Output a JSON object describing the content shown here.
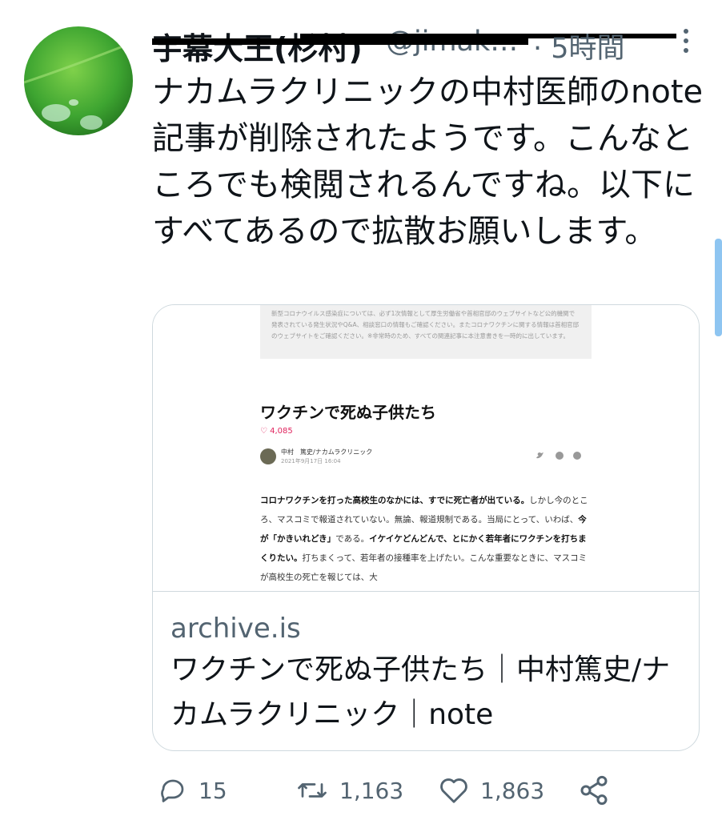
{
  "tweet": {
    "display_name": "宇幕大王(杉村)",
    "handle": "@jimak…",
    "time": "· 5時間",
    "text": "ナカムラクリニックの中村医師のnote記事が削除されたようです。こんなところでも検閲されるんですね。以下にすべてあるので拡散お願いします。"
  },
  "card": {
    "notice": "新型コロナウイルス感染症については、必ず1次情報として厚生労働省や首相官邸のウェブサイトなど公的機関で発表されている発生状況やQ&A、相談窓口の情報もご確認ください。またコロナワクチンに関する情報は首相官邸のウェブサイトをご確認ください。※非常時のため、すべての関連記事に本注意書きを一時的に出しています。",
    "article_title": "ワクチンで死ぬ子供たち",
    "likes": "♡ 4,085",
    "author": "中村　篤史/ナカムラクリニック",
    "date": "2021年9月17日 16:04",
    "body_1": "コロナワクチンを打った高校生のなかには、すでに死亡者が出ている。",
    "body_2": "しかし今のところ、マスコミで報道されていない。無論、報道規制である。当局にとって、いわば、",
    "body_3": "今が「かきいれどき」",
    "body_4": "である。",
    "body_5": "イケイケどんどんで、とにかく若年者にワクチンを打ちまくりたい。",
    "body_6": "打ちまくって、若年者の接種率を上げたい。こんな重要なときに、マスコミが高校生の死亡を報じては、大",
    "domain": "archive.is",
    "title": "ワクチンで死ぬ子供たち｜中村篤史/ナカムラクリニック｜note"
  },
  "actions": {
    "replies": "15",
    "retweets": "1,163",
    "likes": "1,863"
  },
  "icons": [
    "avatar-leaf",
    "more-icon",
    "reply-icon",
    "retweet-icon",
    "like-icon",
    "share-icon"
  ]
}
